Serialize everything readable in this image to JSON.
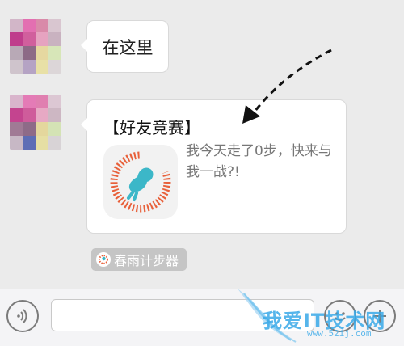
{
  "chat": {
    "message1": {
      "text": "在这里"
    },
    "card": {
      "title": "【好友竞赛】",
      "description": "我今天走了0步，快来与我一战?!",
      "app_icon": "running-figure-icon"
    },
    "source_tag": {
      "label": "春雨计步器"
    }
  },
  "input_bar": {
    "voice_icon": "voice-wave-icon",
    "emoji_icon": "smiley-icon",
    "plus_icon": "plus-icon",
    "text_value": ""
  },
  "watermark": {
    "text": "我爱IT技术网",
    "url": "www.52ij.com"
  },
  "colors": {
    "background": "#ebebeb",
    "bubble": "#ffffff",
    "accent_orange": "#e8603a",
    "accent_cyan": "#3cb7c8",
    "watermark_blue": "#39a9e8"
  }
}
